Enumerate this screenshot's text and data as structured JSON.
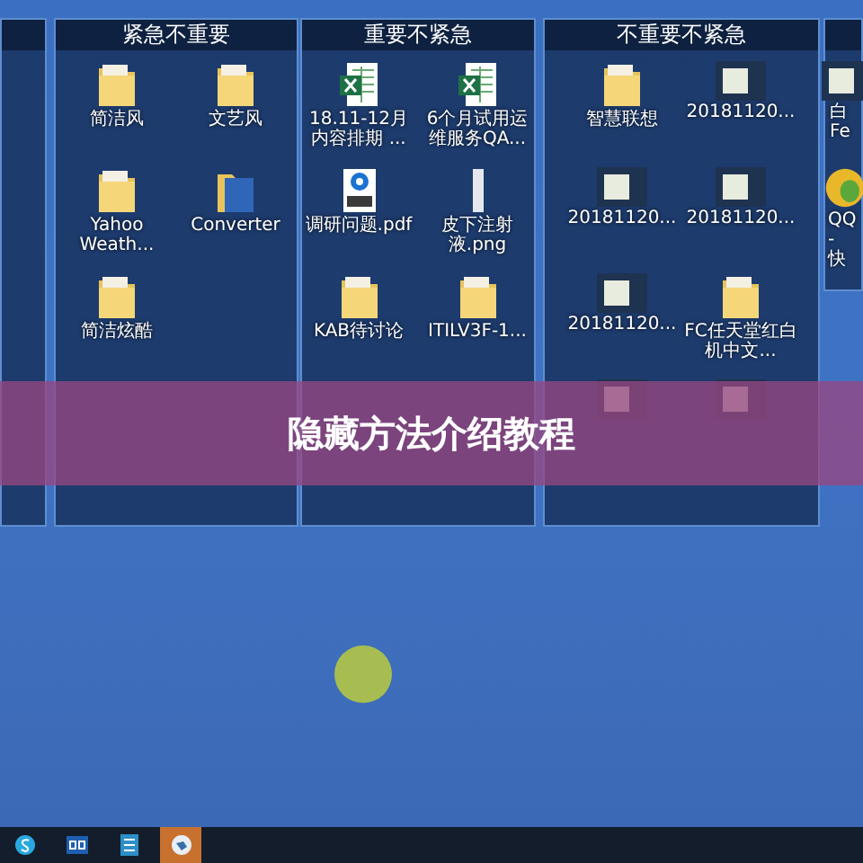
{
  "panels": [
    {
      "kind": "edge"
    },
    {
      "kind": "fence",
      "title": "紧急不重要",
      "items": [
        {
          "kind": "folder",
          "label": "简洁风"
        },
        {
          "kind": "folder",
          "label": "文艺风"
        },
        {
          "kind": "folder",
          "label": "Yahoo Weath..."
        },
        {
          "kind": "bluefolder",
          "label": "Converter"
        },
        {
          "kind": "folder",
          "label": "简洁炫酷"
        }
      ]
    },
    {
      "kind": "fence",
      "title": "重要不紧急",
      "items": [
        {
          "kind": "excel",
          "label": "18.11-12月内容排期 ..."
        },
        {
          "kind": "excel",
          "label": "6个月试用运维服务QA..."
        },
        {
          "kind": "pdf",
          "label": "调研问题.pdf"
        },
        {
          "kind": "image",
          "label": "皮下注射液.png"
        },
        {
          "kind": "folder",
          "label": "KAB待讨论"
        },
        {
          "kind": "folder",
          "label": "ITILV3F-1..."
        }
      ]
    },
    {
      "kind": "fence",
      "title": "不重要不紧急",
      "items": [
        {
          "kind": "folder",
          "label": "智慧联想"
        },
        {
          "kind": "thumbnail",
          "label": "20181120..."
        },
        {
          "kind": "thumbnail",
          "label": "20181120..."
        },
        {
          "kind": "thumbnail",
          "label": "20181120..."
        },
        {
          "kind": "thumbnail",
          "label": "20181120..."
        },
        {
          "kind": "folder",
          "label": "FC任天堂红白机中文..."
        },
        {
          "kind": "thumbnail"
        },
        {
          "kind": "thumbnail"
        }
      ]
    },
    {
      "kind": "edge",
      "items": [
        {
          "kind": "thumbnail",
          "label": "白 Fe"
        },
        {
          "kind": "qq",
          "label": "QQ - 快"
        }
      ]
    }
  ],
  "banner": {
    "title": "隐藏方法介绍教程"
  },
  "taskbar": [
    {
      "kind": "chat",
      "selected": false
    },
    {
      "kind": "mail",
      "selected": false
    },
    {
      "kind": "doc",
      "selected": false
    },
    {
      "kind": "bird",
      "selected": true
    }
  ]
}
